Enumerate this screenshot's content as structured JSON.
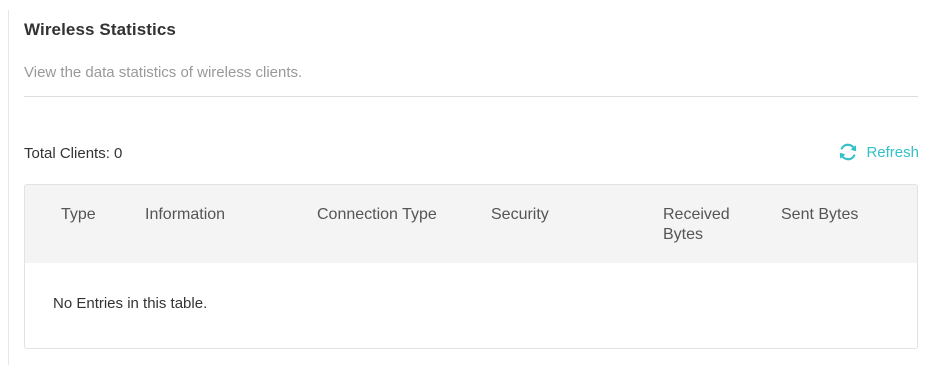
{
  "panel": {
    "title": "Wireless Statistics",
    "subtitle": "View the data statistics of wireless clients."
  },
  "summary": {
    "total_clients_label": "Total Clients: 0",
    "refresh_label": "Refresh"
  },
  "table": {
    "columns": [
      "Type",
      "Information",
      "Connection Type",
      "Security",
      "Received Bytes",
      "Sent Bytes"
    ],
    "empty_message": "No Entries in this table."
  },
  "icons": {
    "refresh": "refresh-icon"
  },
  "colors": {
    "accent": "#33c0c8",
    "header_bg": "#f4f4f4",
    "muted_text": "#999999"
  }
}
